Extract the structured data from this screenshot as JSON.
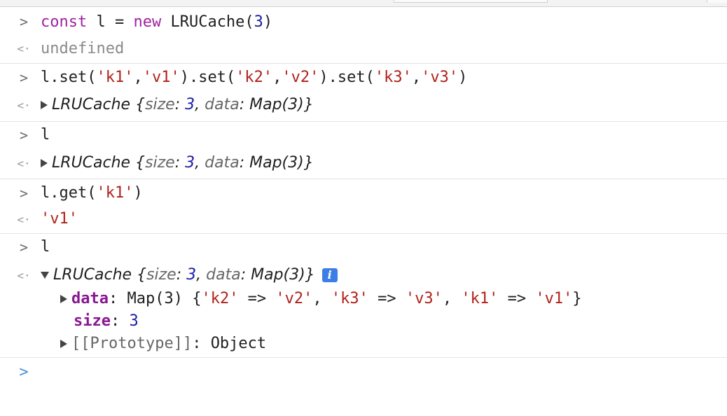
{
  "console": {
    "prompt_glyph": ">",
    "result_glyph": "<·",
    "entries": [
      {
        "input": {
          "kw1": "const",
          "t1": " l = ",
          "kw2": "new",
          "t2": " LRUCache(",
          "num": "3",
          "t3": ")"
        },
        "result": {
          "text": "undefined"
        }
      },
      {
        "input": {
          "a": "l.set(",
          "s1": "'k1'",
          "c1": ",",
          "s2": "'v1'",
          "b": ").set(",
          "s3": "'k2'",
          "c2": ",",
          "s4": "'v2'",
          "c": ").set(",
          "s5": "'k3'",
          "c3": ",",
          "s6": "'v3'",
          "d": ")"
        },
        "result": {
          "cls": "LRUCache",
          "open": " {",
          "k1": "size",
          "colon1": ": ",
          "v1": "3",
          "comma": ", ",
          "k2": "data",
          "colon2": ": ",
          "v2": "Map(3)",
          "close": "}"
        }
      },
      {
        "input": {
          "text": "l"
        },
        "result": {
          "cls": "LRUCache",
          "open": " {",
          "k1": "size",
          "colon1": ": ",
          "v1": "3",
          "comma": ", ",
          "k2": "data",
          "colon2": ": ",
          "v2": "Map(3)",
          "close": "}"
        }
      },
      {
        "input": {
          "a": "l.get(",
          "s": "'k1'",
          "b": ")"
        },
        "result": {
          "text": "'v1'"
        }
      },
      {
        "input": {
          "text": "l"
        },
        "result": {
          "cls": "LRUCache",
          "open": " {",
          "k1": "size",
          "colon1": ": ",
          "v1": "3",
          "comma": ", ",
          "k2": "data",
          "colon2": ": ",
          "v2": "Map(3)",
          "close": "}",
          "info": "i",
          "data_row": {
            "key": "data",
            "colon": ": ",
            "type": "Map(3) {",
            "e1k": "'k2'",
            "arrow": " => ",
            "e1v": "'v2'",
            "sep": ", ",
            "e2k": "'k3'",
            "e2v": "'v3'",
            "e3k": "'k1'",
            "e3v": "'v1'",
            "close": "}"
          },
          "size_row": {
            "key": "size",
            "colon": ": ",
            "value": "3"
          },
          "proto_row": {
            "key": "[[Prototype]]",
            "colon": ": ",
            "value": "Object"
          }
        }
      }
    ]
  }
}
